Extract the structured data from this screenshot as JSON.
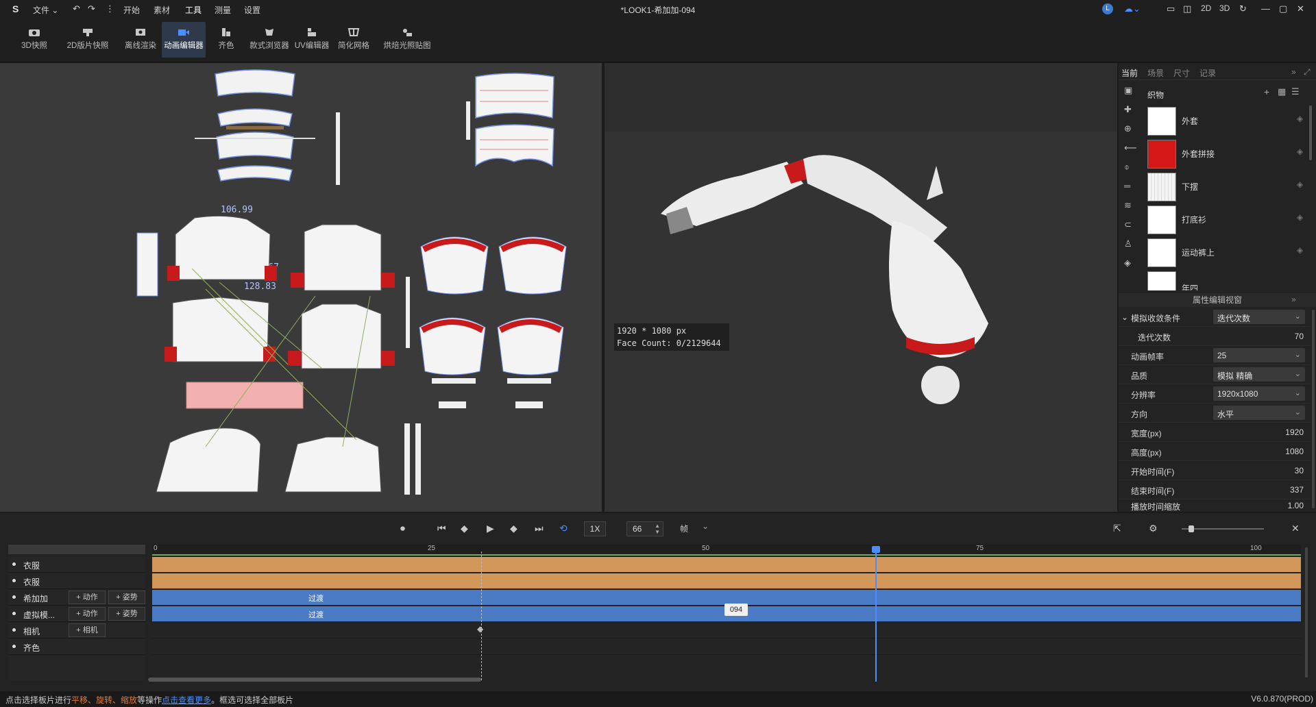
{
  "menu": {
    "file": "文件",
    "start": "开始",
    "material": "素材",
    "tools": "工具",
    "measure": "测量",
    "settings": "设置"
  },
  "window_title": "*LOOK1-希加加-094",
  "view_modes": {
    "two_d": "2D",
    "three_d": "3D"
  },
  "user_avatar": "L",
  "toolbar": [
    {
      "label": "3D快照",
      "icon": "camera-icon"
    },
    {
      "label": "2D版片快照",
      "icon": "pattern-snapshot-icon"
    },
    {
      "label": "离线渲染",
      "icon": "render-icon"
    },
    {
      "label": "动画编辑器",
      "icon": "video-camera-icon",
      "active": true
    },
    {
      "label": "齐色",
      "icon": "colorway-icon"
    },
    {
      "label": "款式浏览器",
      "icon": "style-browser-icon"
    },
    {
      "label": "UV编辑器",
      "icon": "uv-icon"
    },
    {
      "label": "简化网格",
      "icon": "mesh-icon"
    },
    {
      "label": "烘焙光照贴图",
      "icon": "bake-icon"
    }
  ],
  "pattern": {
    "measure1": "106.99",
    "measure2": "120.67",
    "measure3": "128.83"
  },
  "viewport": {
    "resolution": "1920 * 1080 px",
    "face_count": "Face Count: 0/2129644"
  },
  "right_tabs": [
    "当前",
    "场景",
    "尺寸",
    "记录"
  ],
  "fabric_header": "织物",
  "fabrics": [
    {
      "name": "外套",
      "color": "#ffffff"
    },
    {
      "name": "外套拼接",
      "color": "#d41818"
    },
    {
      "name": "下摆",
      "color": "#f4f4f4"
    },
    {
      "name": "打底衫",
      "color": "#ffffff"
    },
    {
      "name": "运动裤上",
      "color": "#ffffff"
    },
    {
      "name": "年四",
      "color": "#ffffff"
    }
  ],
  "prop_panel_title": "属性编辑视窗",
  "props": [
    {
      "label": "模拟收敛条件",
      "select": "迭代次数",
      "expand": true
    },
    {
      "label": "迭代次数",
      "value": "70",
      "indent": true
    },
    {
      "label": "动画帧率",
      "select": "25"
    },
    {
      "label": "品质",
      "select": "模拟 精确"
    },
    {
      "label": "分辨率",
      "select": "1920x1080"
    },
    {
      "label": "方向",
      "select": "水平"
    },
    {
      "label": "宽度(px)",
      "value": "1920"
    },
    {
      "label": "高度(px)",
      "value": "1080"
    },
    {
      "label": "开始时间(F)",
      "value": "30"
    },
    {
      "label": "结束时间(F)",
      "value": "337"
    },
    {
      "label": "播放时间缩放",
      "value": "1.00"
    }
  ],
  "timeline": {
    "speed": "1X",
    "frame": "66",
    "unit": "帧",
    "ruler": [
      "0",
      "25",
      "50",
      "75",
      "100"
    ],
    "tracks": [
      {
        "name": "衣服",
        "type": "clothing"
      },
      {
        "name": "衣服",
        "type": "clothing"
      },
      {
        "name": "希加加",
        "type": "avatar",
        "btn1": "+ 动作",
        "btn2": "+ 姿势",
        "clip": "过渡"
      },
      {
        "name": "虚拟模...",
        "type": "avatar",
        "btn1": "+ 动作",
        "btn2": "+ 姿势",
        "clip": "过渡"
      },
      {
        "name": "相机",
        "type": "camera",
        "btn1": "+ 相机"
      },
      {
        "name": "齐色",
        "type": "colorway"
      }
    ],
    "clip_tag": "094",
    "colors": {
      "clothing": "#d4975a",
      "avatar": "#4a7bc4",
      "playhead": "#4c8dff"
    }
  },
  "status": {
    "part1": "点击选择板片进行",
    "move": "平移、",
    "rotate": "旋转、",
    "scale": "缩放",
    "part2": "等操作",
    "link": "点击查看更多",
    "part3": "。框选可选择全部板片",
    "version": "V6.0.870(PROD)"
  }
}
